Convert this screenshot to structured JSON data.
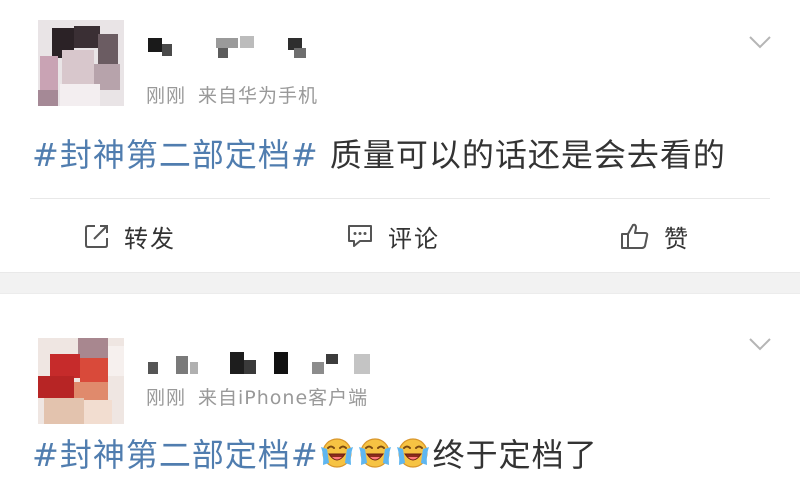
{
  "feed": {
    "posts": [
      {
        "meta_time": "刚刚",
        "meta_source": "来自华为手机",
        "topic": "#封神第二部定档#",
        "body": "质量可以的话还是会去看的",
        "actions": {
          "repost": "转发",
          "comment": "评论",
          "like": "赞"
        }
      },
      {
        "meta_time": "刚刚",
        "meta_source": "来自iPhone客户端",
        "topic": "#封神第二部定档#",
        "body": "终于定档了",
        "emoji_count": 3
      }
    ]
  },
  "colors": {
    "topic": "#507daf",
    "meta": "#999999",
    "text": "#333333",
    "separator": "#f2f2f2"
  },
  "icons": [
    "chevron-down-icon",
    "repost-icon",
    "comment-icon",
    "like-icon",
    "crying-laugh-emoji-icon"
  ]
}
